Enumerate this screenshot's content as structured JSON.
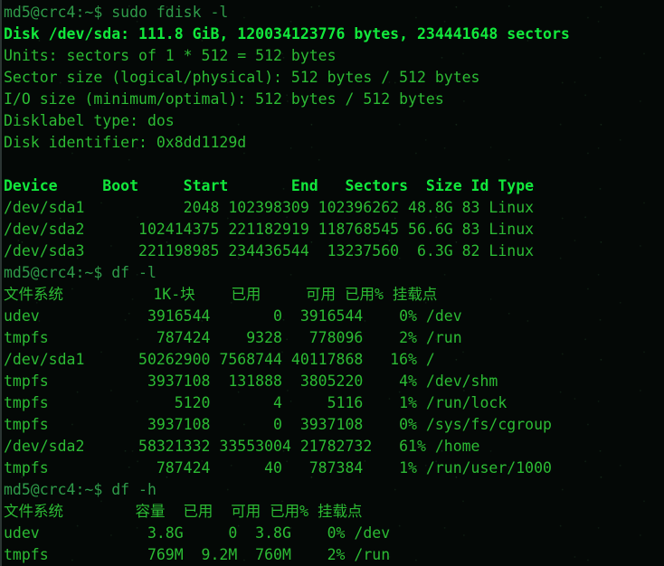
{
  "terminal": {
    "colors": {
      "background": "#040806",
      "prompt": "#2f9c4a",
      "normal": "#2cbb34",
      "bold": "#12e83c",
      "window_border": "#2b3533"
    },
    "prompt_string": "md5@crc4:~$",
    "commands": [
      "sudo fdisk -l",
      "df -l",
      "df -h"
    ],
    "lines": [
      {
        "style": "prompt",
        "text": "md5@crc4:~$ sudo fdisk -l"
      },
      {
        "style": "bold",
        "text": "Disk /dev/sda: 111.8 GiB, 120034123776 bytes, 234441648 sectors"
      },
      {
        "style": "normal",
        "text": "Units: sectors of 1 * 512 = 512 bytes"
      },
      {
        "style": "normal",
        "text": "Sector size (logical/physical): 512 bytes / 512 bytes"
      },
      {
        "style": "normal",
        "text": "I/O size (minimum/optimal): 512 bytes / 512 bytes"
      },
      {
        "style": "normal",
        "text": "Disklabel type: dos"
      },
      {
        "style": "normal",
        "text": "Disk identifier: 0x8dd1129d"
      },
      {
        "style": "blank",
        "text": " "
      },
      {
        "style": "header",
        "text": "Device     Boot     Start       End   Sectors  Size Id Type"
      },
      {
        "style": "normal",
        "text": "/dev/sda1           2048 102398309 102396262 48.8G 83 Linux"
      },
      {
        "style": "normal",
        "text": "/dev/sda2      102414375 221182919 118768545 56.6G 83 Linux"
      },
      {
        "style": "normal",
        "text": "/dev/sda3      221198985 234436544  13237560  6.3G 82 Linux"
      },
      {
        "style": "prompt",
        "text": "md5@crc4:~$ df -l"
      },
      {
        "style": "normal",
        "text": "文件系统          1K-块    已用     可用 已用% 挂载点"
      },
      {
        "style": "normal",
        "text": "udev            3916544       0  3916544    0% /dev"
      },
      {
        "style": "normal",
        "text": "tmpfs            787424    9328   778096    2% /run"
      },
      {
        "style": "normal",
        "text": "/dev/sda1      50262900 7568744 40117868   16% /"
      },
      {
        "style": "normal",
        "text": "tmpfs           3937108  131888  3805220    4% /dev/shm"
      },
      {
        "style": "normal",
        "text": "tmpfs              5120       4     5116    1% /run/lock"
      },
      {
        "style": "normal",
        "text": "tmpfs           3937108       0  3937108    0% /sys/fs/cgroup"
      },
      {
        "style": "normal",
        "text": "/dev/sda2      58321332 33553004 21782732   61% /home"
      },
      {
        "style": "normal",
        "text": "tmpfs            787424      40   787384    1% /run/user/1000"
      },
      {
        "style": "prompt",
        "text": "md5@crc4:~$ df -h"
      },
      {
        "style": "normal",
        "text": "文件系统        容量  已用  可用 已用% 挂载点"
      },
      {
        "style": "normal",
        "text": "udev            3.8G     0  3.8G    0% /dev"
      },
      {
        "style": "normal",
        "text": "tmpfs           769M  9.2M  760M    2% /run"
      }
    ],
    "fdisk": {
      "disk_label": "Disk /dev/sda:",
      "disk_size_human": "111.8 GiB",
      "disk_size_bytes": "120034123776 bytes",
      "disk_sectors": "234441648 sectors",
      "units": "sectors of 1 * 512 = 512 bytes",
      "sector_size": "512 bytes / 512 bytes",
      "io_size": "512 bytes / 512 bytes",
      "disklabel_type": "dos",
      "disk_identifier": "0x8dd1129d",
      "table_headers": [
        "Device",
        "Boot",
        "Start",
        "End",
        "Sectors",
        "Size",
        "Id",
        "Type"
      ],
      "partitions": [
        {
          "device": "/dev/sda1",
          "boot": "",
          "start": "2048",
          "end": "102398309",
          "sectors": "102396262",
          "size": "48.8G",
          "id": "83",
          "type": "Linux"
        },
        {
          "device": "/dev/sda2",
          "boot": "",
          "start": "102414375",
          "end": "221182919",
          "sectors": "118768545",
          "size": "56.6G",
          "id": "83",
          "type": "Linux"
        },
        {
          "device": "/dev/sda3",
          "boot": "",
          "start": "221198985",
          "end": "234436544",
          "sectors": "13237560",
          "size": "6.3G",
          "id": "82",
          "type": "Linux"
        }
      ]
    },
    "df_l": {
      "headers": [
        "文件系统",
        "1K-块",
        "已用",
        "可用",
        "已用%",
        "挂载点"
      ],
      "rows": [
        {
          "filesystem": "udev",
          "blocks": "3916544",
          "used": "0",
          "available": "3916544",
          "use_pct": "0%",
          "mounted_on": "/dev"
        },
        {
          "filesystem": "tmpfs",
          "blocks": "787424",
          "used": "9328",
          "available": "778096",
          "use_pct": "2%",
          "mounted_on": "/run"
        },
        {
          "filesystem": "/dev/sda1",
          "blocks": "50262900",
          "used": "7568744",
          "available": "40117868",
          "use_pct": "16%",
          "mounted_on": "/"
        },
        {
          "filesystem": "tmpfs",
          "blocks": "3937108",
          "used": "131888",
          "available": "3805220",
          "use_pct": "4%",
          "mounted_on": "/dev/shm"
        },
        {
          "filesystem": "tmpfs",
          "blocks": "5120",
          "used": "4",
          "available": "5116",
          "use_pct": "1%",
          "mounted_on": "/run/lock"
        },
        {
          "filesystem": "tmpfs",
          "blocks": "3937108",
          "used": "0",
          "available": "3937108",
          "use_pct": "0%",
          "mounted_on": "/sys/fs/cgroup"
        },
        {
          "filesystem": "/dev/sda2",
          "blocks": "58321332",
          "used": "33553004",
          "available": "21782732",
          "use_pct": "61%",
          "mounted_on": "/home"
        },
        {
          "filesystem": "tmpfs",
          "blocks": "787424",
          "used": "40",
          "available": "787384",
          "use_pct": "1%",
          "mounted_on": "/run/user/1000"
        }
      ]
    },
    "df_h": {
      "headers": [
        "文件系统",
        "容量",
        "已用",
        "可用",
        "已用%",
        "挂载点"
      ],
      "rows": [
        {
          "filesystem": "udev",
          "size": "3.8G",
          "used": "0",
          "available": "3.8G",
          "use_pct": "0%",
          "mounted_on": "/dev"
        },
        {
          "filesystem": "tmpfs",
          "size": "769M",
          "used": "9.2M",
          "available": "760M",
          "use_pct": "2%",
          "mounted_on": "/run"
        }
      ]
    }
  }
}
